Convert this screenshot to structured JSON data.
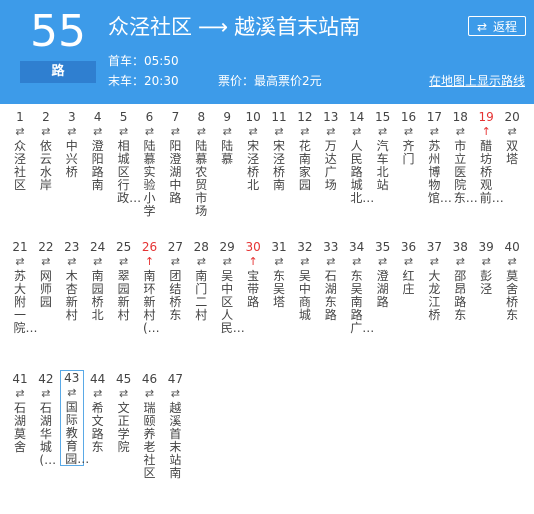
{
  "route": {
    "number": "55",
    "unit": "路",
    "from": "众泾社区",
    "arrow": "⟶",
    "to": "越溪首末站南",
    "first_bus": "首车：05:50",
    "last_bus": "末车：20:30",
    "fare": "票价：最高票价2元",
    "map_link": "在地图上显示路线",
    "return_label": "返程",
    "return_icon": "⇄"
  },
  "stops": [
    {
      "n": "1",
      "name": "众泾社区"
    },
    {
      "n": "2",
      "name": "依云水岸"
    },
    {
      "n": "3",
      "name": "中兴桥"
    },
    {
      "n": "4",
      "name": "澄阳路南"
    },
    {
      "n": "5",
      "name": "相城区行政…"
    },
    {
      "n": "6",
      "name": "陆慕实验小学"
    },
    {
      "n": "7",
      "name": "阳澄湖中路"
    },
    {
      "n": "8",
      "name": "陆慕农贸市场"
    },
    {
      "n": "9",
      "name": "陆慕"
    },
    {
      "n": "10",
      "name": "宋泾桥北"
    },
    {
      "n": "11",
      "name": "宋泾桥南"
    },
    {
      "n": "12",
      "name": "花南家园"
    },
    {
      "n": "13",
      "name": "万达广场"
    },
    {
      "n": "14",
      "name": "人民路城北…"
    },
    {
      "n": "15",
      "name": "汽车北站"
    },
    {
      "n": "16",
      "name": "齐门"
    },
    {
      "n": "17",
      "name": "苏州博物馆…"
    },
    {
      "n": "18",
      "name": "市立医院东…"
    },
    {
      "n": "19",
      "name": "醋坊桥观前…",
      "red": true
    },
    {
      "n": "20",
      "name": "双塔"
    },
    {
      "n": "21",
      "name": "苏大附一院…"
    },
    {
      "n": "22",
      "name": "网师园"
    },
    {
      "n": "23",
      "name": "木杏新村"
    },
    {
      "n": "24",
      "name": "南园桥北"
    },
    {
      "n": "25",
      "name": "翠园新村"
    },
    {
      "n": "26",
      "name": "南环新村(…",
      "red": true
    },
    {
      "n": "27",
      "name": "团结桥东"
    },
    {
      "n": "28",
      "name": "南门二村"
    },
    {
      "n": "29",
      "name": "吴中区人民…"
    },
    {
      "n": "30",
      "name": "宝带路",
      "red": true
    },
    {
      "n": "31",
      "name": "东吴塔"
    },
    {
      "n": "32",
      "name": "吴中商城"
    },
    {
      "n": "33",
      "name": "石湖东路"
    },
    {
      "n": "34",
      "name": "东吴南路广…"
    },
    {
      "n": "35",
      "name": "澄湖路"
    },
    {
      "n": "36",
      "name": "红庄"
    },
    {
      "n": "37",
      "name": "大龙江桥"
    },
    {
      "n": "38",
      "name": "邵昂路东"
    },
    {
      "n": "39",
      "name": "彭泾"
    },
    {
      "n": "40",
      "name": "莫舍桥东"
    },
    {
      "n": "41",
      "name": "石湖莫舍"
    },
    {
      "n": "42",
      "name": "石湖华城(…"
    },
    {
      "n": "43",
      "name": "国际教育园…",
      "selected": true
    },
    {
      "n": "44",
      "name": "希文路东"
    },
    {
      "n": "45",
      "name": "文正学院"
    },
    {
      "n": "46",
      "name": "瑞颐养老社区"
    },
    {
      "n": "47",
      "name": "越溪首末站南"
    }
  ],
  "arrows": {
    "normal": "⇄",
    "red": "↑"
  },
  "colors": {
    "header": "#3d9be9",
    "accent_red": "#e53333"
  }
}
